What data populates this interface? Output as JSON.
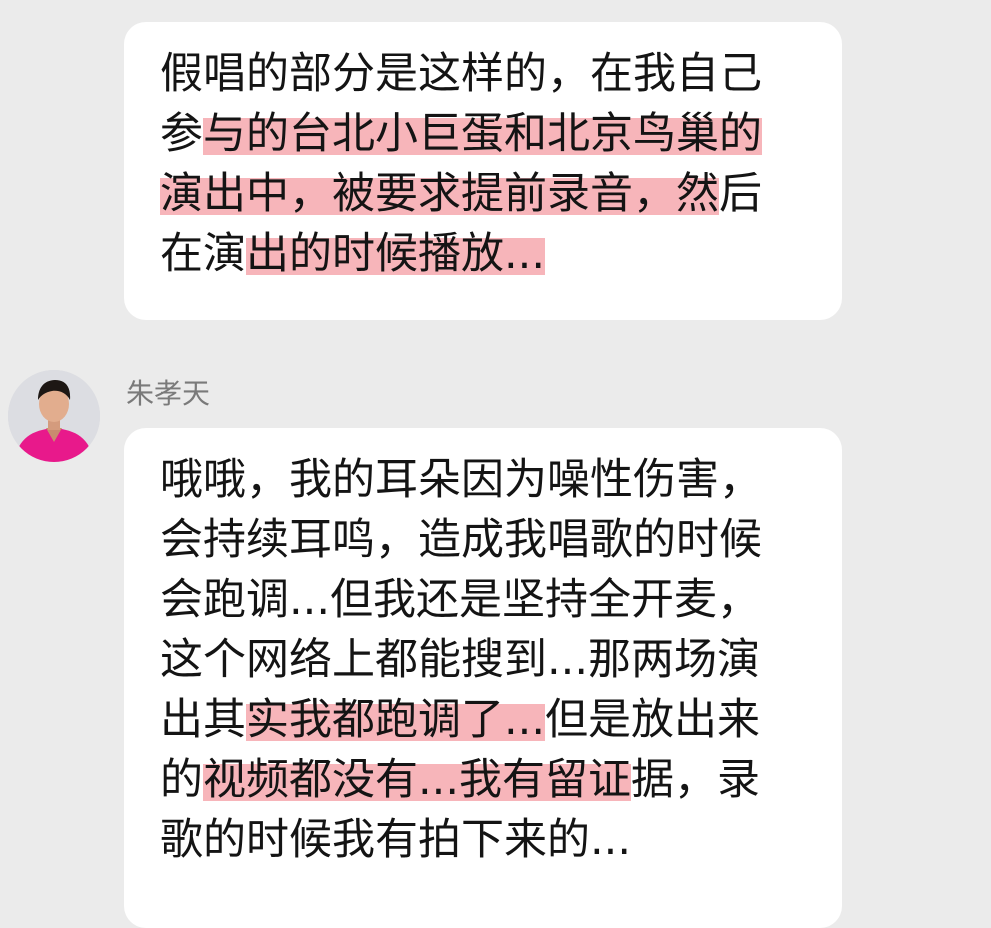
{
  "messages": [
    {
      "lines": [
        [
          {
            "text": "假唱的部分是这样的，在我自己",
            "hl": false
          }
        ],
        [
          {
            "text": "参",
            "hl": false
          },
          {
            "text": "与的台北小巨蛋和北京鸟巢的",
            "hl": true
          }
        ],
        [
          {
            "text": "演出中，被要求提前录音，然",
            "hl": true
          },
          {
            "text": "后",
            "hl": false
          }
        ],
        [
          {
            "text": "在演",
            "hl": false
          },
          {
            "text": "出的时候播放...",
            "hl": true
          }
        ]
      ]
    },
    {
      "sender": {
        "name": "朱孝天",
        "avatar_icon": "avatar-photo"
      },
      "lines": [
        [
          {
            "text": "哦哦，我的耳朵因为噪性伤害，",
            "hl": false
          }
        ],
        [
          {
            "text": "会持续耳鸣，造成我唱歌的时候",
            "hl": false
          }
        ],
        [
          {
            "text": "会跑调...但我还是坚持全开麦，",
            "hl": false
          }
        ],
        [
          {
            "text": "这个网络上都能搜到...那两场演",
            "hl": false
          }
        ],
        [
          {
            "text": "出其",
            "hl": false
          },
          {
            "text": "实我都跑调了...",
            "hl": true
          },
          {
            "text": "但是放出来",
            "hl": false
          }
        ],
        [
          {
            "text": "的",
            "hl": false
          },
          {
            "text": "视频都没有...我有留证",
            "hl": true
          },
          {
            "text": "据，录",
            "hl": false
          }
        ],
        [
          {
            "text": "歌的时候我有拍下来的...",
            "hl": false
          }
        ]
      ]
    }
  ],
  "colors": {
    "background": "#ebebeb",
    "bubble": "#ffffff",
    "text": "#141414",
    "highlight": "#f07882",
    "sender_name": "#7a7a7a",
    "avatar_shirt": "#e8198b"
  }
}
